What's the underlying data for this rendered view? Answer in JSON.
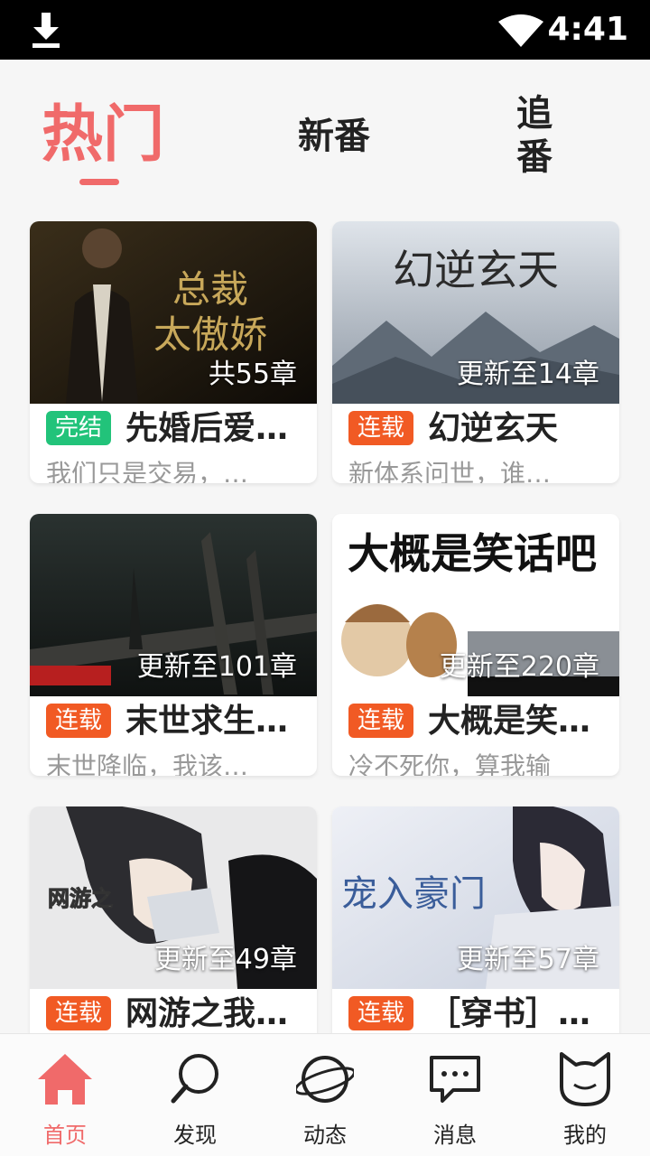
{
  "status_bar": {
    "time": "4:41",
    "icons": [
      "download-icon",
      "wifi-icon"
    ]
  },
  "tabs": [
    {
      "label": "热门",
      "active": true
    },
    {
      "label": "新番",
      "active": false
    },
    {
      "label": "追番",
      "active": false
    }
  ],
  "cards": [
    {
      "status": "完结",
      "title": "先婚后爱…",
      "chapter": "共55章",
      "desc": "我们只是交易，…"
    },
    {
      "status": "连载",
      "title": "幻逆玄天",
      "chapter": "更新至14章",
      "desc": "新体系问世，谁…"
    },
    {
      "status": "连载",
      "title": "末世求生…",
      "chapter": "更新至101章",
      "desc": "末世降临，我该…"
    },
    {
      "status": "连载",
      "title": "大概是笑…",
      "chapter": "更新至220章",
      "desc": "冷不死你，算我输"
    },
    {
      "status": "连载",
      "title": "网游之我…",
      "chapter": "更新至49章",
      "desc": ""
    },
    {
      "status": "连载",
      "title": "［穿书］…",
      "chapter": "更新至57章",
      "desc": ""
    }
  ],
  "bottom_nav": [
    {
      "label": "首页",
      "icon": "home-icon",
      "active": true
    },
    {
      "label": "发现",
      "icon": "search-icon",
      "active": false
    },
    {
      "label": "动态",
      "icon": "planet-icon",
      "active": false
    },
    {
      "label": "消息",
      "icon": "message-icon",
      "active": false
    },
    {
      "label": "我的",
      "icon": "cat-profile-icon",
      "active": false
    }
  ],
  "colors": {
    "accent": "#f06a6a",
    "done": "#22c37a",
    "ongoing": "#f15a24"
  }
}
